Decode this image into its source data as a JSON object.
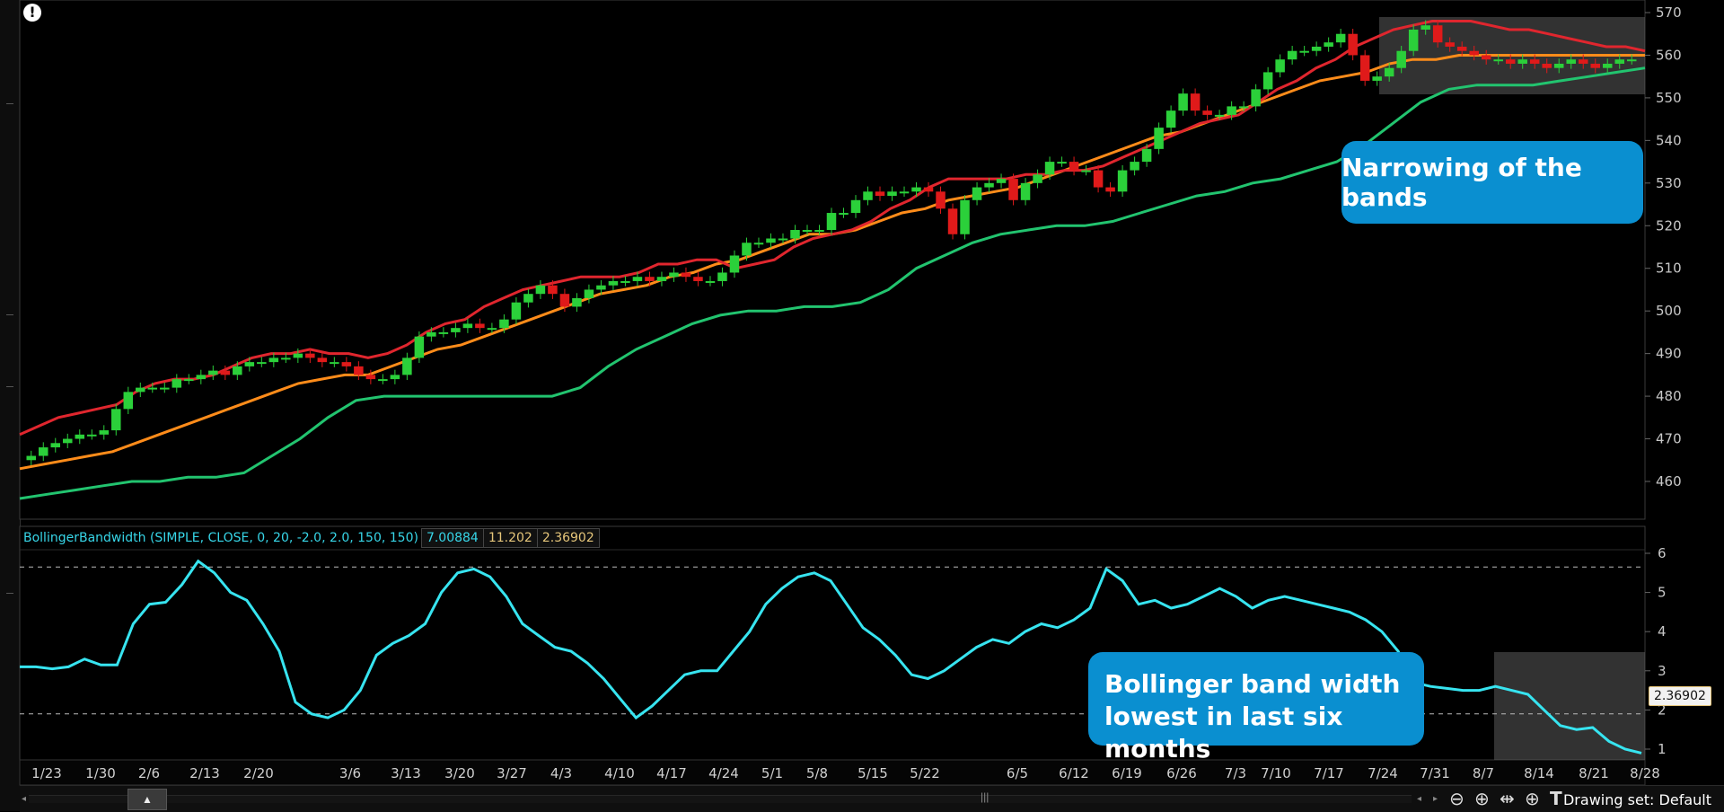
{
  "chart_data": [
    {
      "type": "candlestick",
      "title": "",
      "ylabel": "",
      "yticks": [
        460,
        470,
        480,
        490,
        500,
        510,
        520,
        530,
        540,
        550,
        560,
        570
      ],
      "ylim": [
        452,
        573
      ],
      "colors": {
        "up": "#2bd03a",
        "down": "#e01a1a",
        "upper_band": "#e0262e",
        "mid_band": "#ff8c1a",
        "lower_band": "#22c46f"
      },
      "candles_close": [
        466,
        468,
        469,
        470,
        471,
        471,
        472,
        477,
        481,
        482,
        482,
        482,
        484,
        484,
        485,
        486,
        485,
        487,
        488,
        488,
        489,
        489,
        490,
        489,
        488,
        488,
        487,
        485,
        484,
        484,
        485,
        489,
        494,
        495,
        495,
        496,
        497,
        496,
        496,
        498,
        502,
        504,
        506,
        504,
        501,
        503,
        505,
        506,
        507,
        507,
        508,
        507,
        508,
        509,
        508,
        507,
        507,
        509,
        513,
        516,
        516,
        517,
        517,
        519,
        519,
        519,
        523,
        523,
        526,
        528,
        527,
        528,
        528,
        529,
        528,
        524,
        518,
        526,
        529,
        530,
        531,
        526,
        530,
        532,
        535,
        535,
        533,
        533,
        529,
        528,
        533,
        535,
        538,
        543,
        547,
        551,
        547,
        546,
        546,
        548,
        548,
        552,
        556,
        559,
        561,
        561,
        562,
        563,
        565,
        560,
        554,
        555,
        557,
        561,
        566,
        567,
        563,
        562,
        561,
        560,
        559,
        559,
        558,
        559,
        558,
        557,
        558,
        559,
        558,
        557,
        558,
        559,
        559
      ],
      "upper_band": [
        471,
        473,
        475,
        476,
        477,
        478,
        481,
        483,
        484,
        484,
        485,
        487,
        489,
        490,
        490,
        491,
        490,
        490,
        489,
        490,
        492,
        495,
        497,
        498,
        501,
        503,
        505,
        506,
        507,
        508,
        508,
        508,
        509,
        511,
        511,
        512,
        512,
        510,
        511,
        512,
        515,
        517,
        518,
        519,
        521,
        524,
        526,
        529,
        531,
        531,
        531,
        531,
        532,
        532,
        533,
        533,
        534,
        536,
        538,
        540,
        542,
        544,
        545,
        546,
        549,
        552,
        554,
        557,
        559,
        562,
        564,
        566,
        567,
        568,
        568,
        568,
        567,
        566,
        566,
        565,
        564,
        563,
        562,
        562,
        561
      ],
      "mid_band": [
        463,
        464,
        465,
        466,
        467,
        469,
        471,
        473,
        475,
        477,
        479,
        481,
        483,
        484,
        485,
        485,
        487,
        489,
        491,
        492,
        494,
        496,
        498,
        500,
        502,
        504,
        505,
        506,
        508,
        509,
        511,
        512,
        514,
        516,
        518,
        518,
        519,
        521,
        523,
        524,
        526,
        527,
        528,
        529,
        531,
        533,
        535,
        537,
        539,
        541,
        542,
        544,
        546,
        548,
        550,
        552,
        554,
        555,
        556,
        558,
        559,
        559,
        560,
        560,
        560,
        560,
        560,
        560,
        560,
        560,
        560
      ],
      "lower_band": [
        456,
        457,
        458,
        459,
        460,
        460,
        461,
        461,
        462,
        466,
        470,
        475,
        479,
        480,
        480,
        480,
        480,
        480,
        480,
        480,
        482,
        487,
        491,
        494,
        497,
        499,
        500,
        500,
        501,
        501,
        502,
        505,
        510,
        513,
        516,
        518,
        519,
        520,
        520,
        521,
        523,
        525,
        527,
        528,
        530,
        531,
        533,
        535,
        539,
        544,
        549,
        552,
        553,
        553,
        553,
        554,
        555,
        556,
        557
      ]
    },
    {
      "type": "line",
      "study": "BollingerBandwidth (SIMPLE, CLOSE, 0, 20, -2.0, 2.0, 150, 150)",
      "values_label": [
        "7.00884",
        "11.202",
        "2.36902"
      ],
      "yticks": [
        1,
        2,
        3,
        4,
        5,
        6
      ],
      "ylim": [
        0.8,
        6.2
      ],
      "x_dates": [
        "1/23",
        "1/30",
        "2/6",
        "2/13",
        "2/20",
        "3/6",
        "3/13",
        "3/20",
        "3/27",
        "4/3",
        "4/10",
        "4/17",
        "4/24",
        "5/1",
        "5/8",
        "5/15",
        "5/22",
        "6/5",
        "6/12",
        "6/19",
        "6/26",
        "7/3",
        "7/10",
        "7/17",
        "7/24",
        "7/31",
        "8/7",
        "8/14",
        "8/21",
        "8/28"
      ],
      "color": "#37e4f0",
      "values": [
        3.1,
        3.1,
        3.05,
        3.1,
        3.3,
        3.15,
        3.15,
        4.2,
        4.7,
        4.75,
        5.2,
        5.8,
        5.5,
        5.0,
        4.8,
        4.2,
        3.5,
        2.2,
        1.9,
        1.8,
        2.0,
        2.5,
        3.4,
        3.7,
        3.9,
        4.2,
        5.0,
        5.5,
        5.6,
        5.4,
        4.9,
        4.2,
        3.9,
        3.6,
        3.5,
        3.2,
        2.8,
        2.3,
        1.8,
        2.1,
        2.5,
        2.9,
        3.0,
        3.0,
        3.5,
        4.0,
        4.7,
        5.1,
        5.4,
        5.5,
        5.3,
        4.7,
        4.1,
        3.8,
        3.4,
        2.9,
        2.8,
        3.0,
        3.3,
        3.6,
        3.8,
        3.7,
        4.0,
        4.2,
        4.1,
        4.3,
        4.6,
        5.6,
        5.3,
        4.7,
        4.8,
        4.6,
        4.7,
        4.9,
        5.1,
        4.9,
        4.6,
        4.8,
        4.9,
        4.8,
        4.7,
        4.6,
        4.5,
        4.3,
        4.0,
        3.5,
        2.7,
        2.6,
        2.55,
        2.5,
        2.5,
        2.6,
        2.5,
        2.4,
        2.0,
        1.6,
        1.5,
        1.55,
        1.2,
        1.0,
        0.9
      ],
      "upper_level": 5.65,
      "lower_level": 1.9,
      "last_value": "2.36902"
    }
  ],
  "callouts": {
    "top": "Narrowing of the bands",
    "bottom_line1": "Bollinger band width",
    "bottom_line2": "lowest in last six months"
  },
  "toolbar": {
    "drawing_set": "Drawing set: Default"
  }
}
